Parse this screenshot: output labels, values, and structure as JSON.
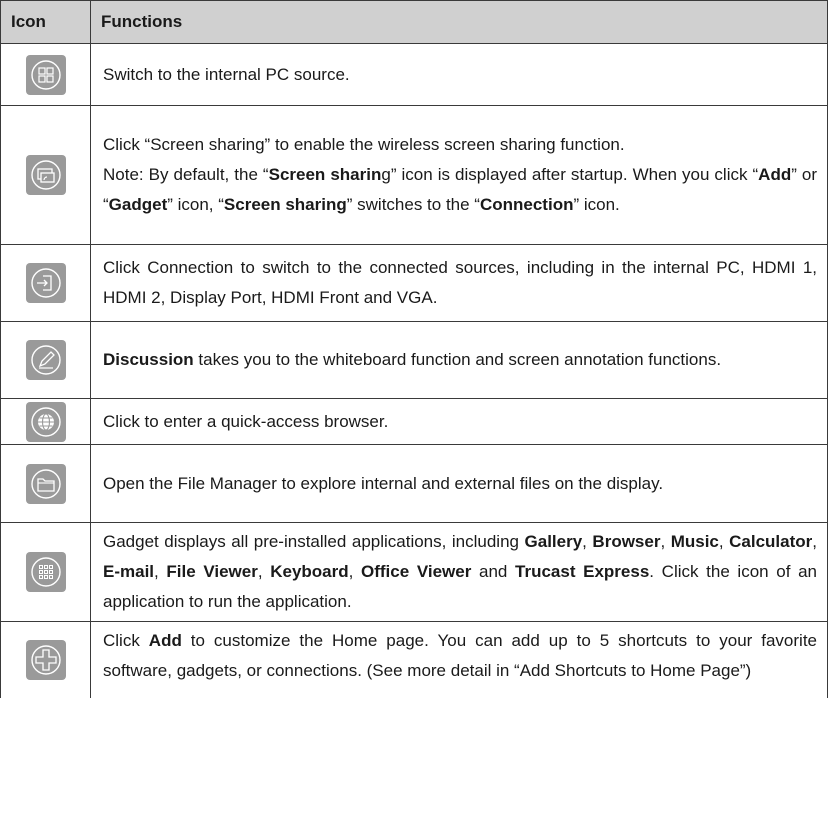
{
  "table": {
    "headers": {
      "icon": "Icon",
      "functions": "Functions"
    },
    "rows": [
      {
        "icon": "pc-source-icon",
        "segments": [
          {
            "t": "Switch to the internal PC source."
          }
        ]
      },
      {
        "icon": "screen-sharing-icon",
        "segments": [
          {
            "t": "Click “Screen sharing” to enable the wireless screen sharing function."
          },
          {
            "br": true
          },
          {
            "t": "Note: By default, the “"
          },
          {
            "t": "Screen sharin",
            "b": true
          },
          {
            "t": "g” icon is displayed after startup. When you click “"
          },
          {
            "t": "Add",
            "b": true
          },
          {
            "t": "” or “"
          },
          {
            "t": "Gadget",
            "b": true
          },
          {
            "t": "” icon, “"
          },
          {
            "t": "Screen sharing",
            "b": true
          },
          {
            "t": "” switches to the “"
          },
          {
            "t": "Connection",
            "b": true
          },
          {
            "t": "” icon."
          }
        ]
      },
      {
        "icon": "connection-icon",
        "segments": [
          {
            "t": "Click Connection to switch to the connected sources, including in the internal PC, HDMI 1, HDMI 2, Display Port, HDMI Front and VGA."
          }
        ]
      },
      {
        "icon": "discussion-icon",
        "segments": [
          {
            "t": "Discussion",
            "b": true
          },
          {
            "t": " takes you to the whiteboard function and screen annotation functions."
          }
        ]
      },
      {
        "icon": "browser-icon",
        "segments": [
          {
            "t": "Click to enter a quick-access browser."
          }
        ]
      },
      {
        "icon": "file-manager-icon",
        "segments": [
          {
            "t": "Open the File Manager to explore internal and external files on the display."
          }
        ]
      },
      {
        "icon": "gadget-icon",
        "segments": [
          {
            "t": "Gadget displays all pre-installed applications, including "
          },
          {
            "t": "Gallery",
            "b": true
          },
          {
            "t": ", "
          },
          {
            "t": "Browser",
            "b": true
          },
          {
            "t": ", "
          },
          {
            "t": "Music",
            "b": true
          },
          {
            "t": ", "
          },
          {
            "t": "Calculator",
            "b": true
          },
          {
            "t": ", "
          },
          {
            "t": "E-mail",
            "b": true
          },
          {
            "t": ", "
          },
          {
            "t": "File Viewer",
            "b": true
          },
          {
            "t": ", "
          },
          {
            "t": "Keyboard",
            "b": true
          },
          {
            "t": ", "
          },
          {
            "t": "Office Viewer",
            "b": true
          },
          {
            "t": " and "
          },
          {
            "t": "Trucast Express",
            "b": true
          },
          {
            "t": ". Click the icon of an application to run the application."
          }
        ]
      },
      {
        "icon": "add-icon",
        "segments": [
          {
            "t": "Click "
          },
          {
            "t": "Add",
            "b": true
          },
          {
            "t": " to customize the Home page. You can add up to 5 shortcuts to your favorite software, gadgets, or connections. (See more detail in “Add Shortcuts to Home Page”)"
          }
        ]
      }
    ]
  }
}
